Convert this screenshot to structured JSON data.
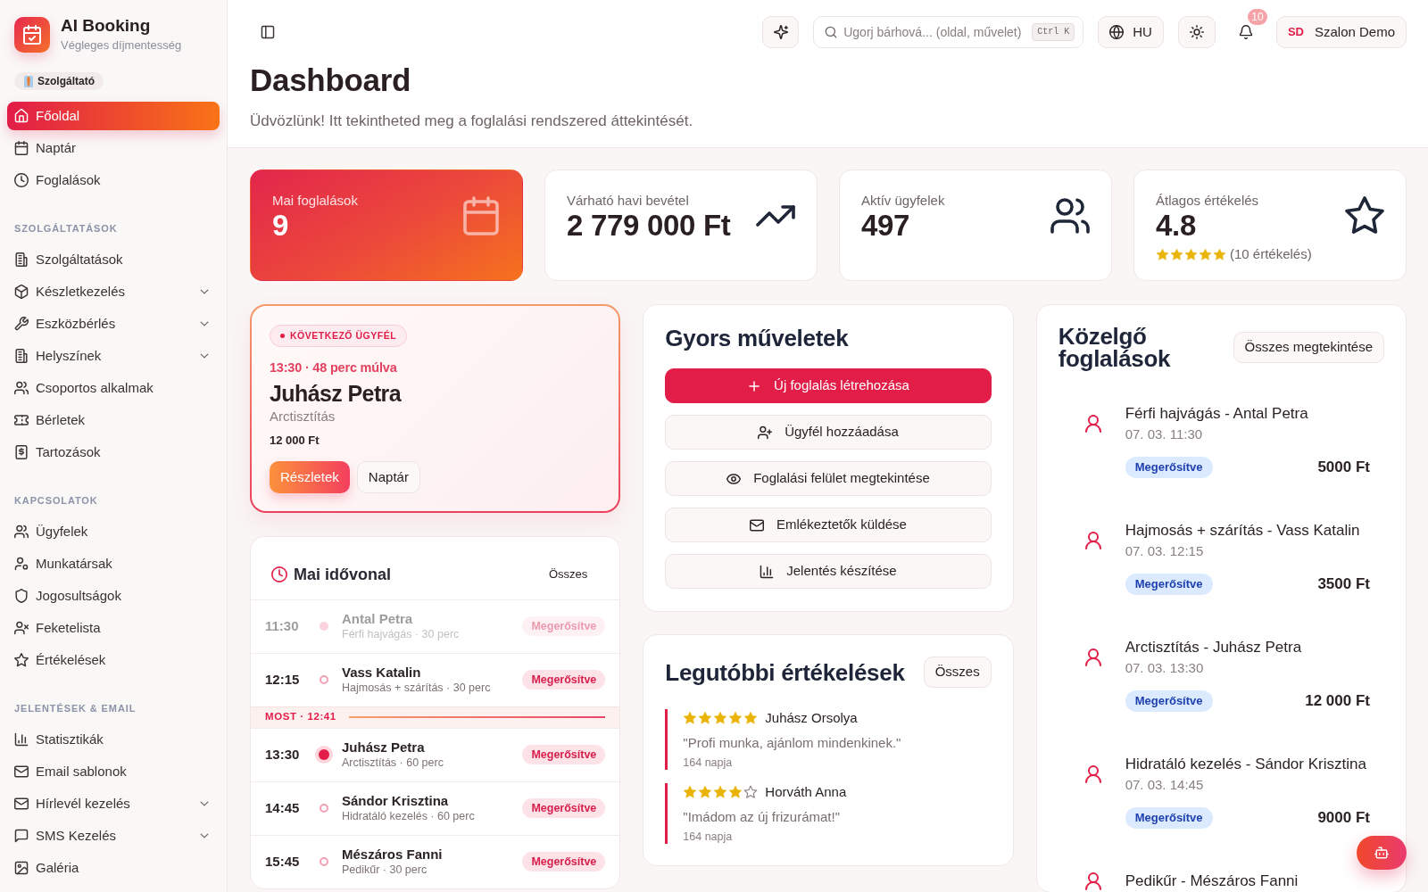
{
  "sidebar": {
    "brand": {
      "title": "AI Booking",
      "subtitle": "Végleges díjmentesség"
    },
    "role": "Szolgáltató",
    "sections": [
      {
        "items": [
          {
            "label": "Főoldal",
            "selected": true,
            "submenu": false
          },
          {
            "label": "Naptár",
            "selected": false,
            "submenu": false
          },
          {
            "label": "Foglalások",
            "selected": false,
            "submenu": false
          }
        ]
      },
      {
        "heading": "SZOLGÁLTATÁSOK",
        "items": [
          {
            "label": "Szolgáltatások",
            "selected": false,
            "submenu": false
          },
          {
            "label": "Készletkezelés",
            "selected": false,
            "submenu": true
          },
          {
            "label": "Eszközbérlés",
            "selected": false,
            "submenu": true
          },
          {
            "label": "Helyszínek",
            "selected": false,
            "submenu": true
          },
          {
            "label": "Csoportos alkalmak",
            "selected": false,
            "submenu": false
          },
          {
            "label": "Bérletek",
            "selected": false,
            "submenu": false
          },
          {
            "label": "Tartozások",
            "selected": false,
            "submenu": false
          }
        ]
      },
      {
        "heading": "KAPCSOLATOK",
        "items": [
          {
            "label": "Ügyfelek",
            "selected": false,
            "submenu": false
          },
          {
            "label": "Munkatársak",
            "selected": false,
            "submenu": false
          },
          {
            "label": "Jogosultságok",
            "selected": false,
            "submenu": false
          },
          {
            "label": "Feketelista",
            "selected": false,
            "submenu": false
          },
          {
            "label": "Értékelések",
            "selected": false,
            "submenu": false
          }
        ]
      },
      {
        "heading": "JELENTÉSEK & EMAIL",
        "items": [
          {
            "label": "Statisztikák",
            "selected": false,
            "submenu": false
          },
          {
            "label": "Email sablonok",
            "selected": false,
            "submenu": false
          },
          {
            "label": "Hírlevél kezelés",
            "selected": false,
            "submenu": true
          },
          {
            "label": "SMS Kezelés",
            "selected": false,
            "submenu": true
          },
          {
            "label": "Galéria",
            "selected": false,
            "submenu": false
          }
        ]
      }
    ]
  },
  "topbar": {
    "search": {
      "placeholder": "Ugorj bárhová... (oldal, művelet)",
      "shortcut": "Ctrl K"
    },
    "language": "HU",
    "notification_count": "10",
    "user": {
      "initials": "SD",
      "name": "Szalon Demo"
    }
  },
  "page": {
    "title": "Dashboard",
    "subtitle": "Üdvözlünk! Itt tekintheted meg a foglalási rendszered áttekintését."
  },
  "stats": [
    {
      "label": "Mai foglalások",
      "value": "9",
      "highlighted": true
    },
    {
      "label": "Várható havi bevétel",
      "value": "2 779 000 Ft",
      "highlighted": false
    },
    {
      "label": "Aktív ügyfelek",
      "value": "497",
      "highlighted": false
    },
    {
      "label": "Átlagos értékelés",
      "value": "4.8",
      "highlighted": false,
      "stars": 5,
      "caption": "(10 értékelés)"
    }
  ],
  "next_client": {
    "badge": "KÖVETKEZŐ ÜGYFÉL",
    "time": "13:30 · 48 perc múlva",
    "name": "Juhász Petra",
    "service": "Arctisztítás",
    "price": "12 000 Ft",
    "buttons": [
      {
        "label": "Részletek",
        "kind": "primary"
      },
      {
        "label": "Naptár",
        "kind": "secondary"
      }
    ]
  },
  "timeline": {
    "title": "Mai idővonal",
    "link": "Összes",
    "entries": [
      {
        "kind": "past",
        "time": "11:30",
        "name": "Antal Petra",
        "detail": "Férfi hajvágás · 30 perc",
        "status": "Megerősítve"
      },
      {
        "kind": "upcoming",
        "time": "12:15",
        "name": "Vass Katalin",
        "detail": "Hajmosás + szárítás · 30 perc",
        "status": "Megerősítve"
      },
      {
        "kind": "now",
        "label": "MOST · 12:41"
      },
      {
        "kind": "current",
        "time": "13:30",
        "name": "Juhász Petra",
        "detail": "Arctisztítás · 60 perc",
        "status": "Megerősítve"
      },
      {
        "kind": "upcoming",
        "time": "14:45",
        "name": "Sándor Krisztina",
        "detail": "Hidratáló kezelés · 60 perc",
        "status": "Megerősítve"
      },
      {
        "kind": "upcoming",
        "time": "15:45",
        "name": "Mészáros Fanni",
        "detail": "Pedikűr · 30 perc",
        "status": "Megerősítve"
      }
    ]
  },
  "quick_actions": {
    "title": "Gyors műveletek",
    "buttons": [
      {
        "label": "Új foglalás létrehozása",
        "kind": "primary"
      },
      {
        "label": "Ügyfél hozzáadása",
        "kind": "secondary"
      },
      {
        "label": "Foglalási felület megtekintése",
        "kind": "secondary"
      },
      {
        "label": "Emlékeztetők küldése",
        "kind": "secondary"
      },
      {
        "label": "Jelentés készítése",
        "kind": "secondary"
      }
    ]
  },
  "reviews": {
    "title": "Legutóbbi értékelések",
    "link": "Összes",
    "items": [
      {
        "stars": 5,
        "author": "Juhász Orsolya",
        "text": "\"Profi munka, ajánlom mindenkinek.\"",
        "age": "164 napja"
      },
      {
        "stars": 4,
        "author": "Horváth Anna",
        "text": "\"Imádom az új frizurámat!\"",
        "age": "164 napja"
      }
    ]
  },
  "upcoming": {
    "title": "Közelgő foglalások",
    "link": "Összes megtekintése",
    "items": [
      {
        "title": "Férfi hajvágás - Antal Petra",
        "datetime": "07. 03. 11:30",
        "status": "Megerősítve",
        "price": "5000 Ft"
      },
      {
        "title": "Hajmosás + szárítás - Vass Katalin",
        "datetime": "07. 03. 12:15",
        "status": "Megerősítve",
        "price": "3500 Ft"
      },
      {
        "title": "Arctisztítás - Juhász Petra",
        "datetime": "07. 03. 13:30",
        "status": "Megerősítve",
        "price": "12 000 Ft"
      },
      {
        "title": "Hidratáló kezelés - Sándor Krisztina",
        "datetime": "07. 03. 14:45",
        "status": "Megerősítve",
        "price": "9000 Ft"
      },
      {
        "title": "Pedikűr - Mészáros Fanni"
      }
    ]
  }
}
